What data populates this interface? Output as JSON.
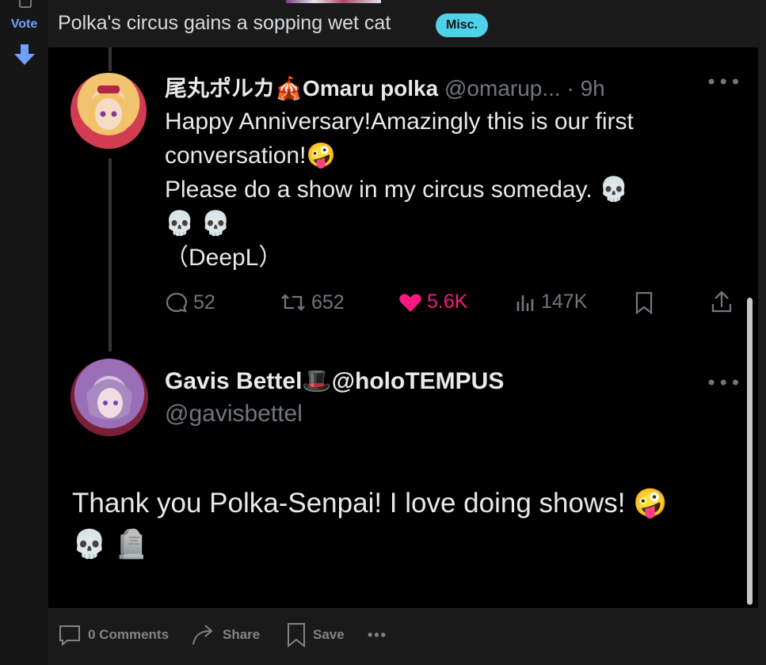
{
  "vote": {
    "label": "Vote"
  },
  "post": {
    "title": "Polka's circus gains a sopping wet cat",
    "flair": "Misc."
  },
  "tweet1": {
    "display_name": "尾丸ポルカ",
    "name_suffix": "Omaru polka",
    "handle": "@omarup...",
    "time": "· 9h",
    "line1": "Happy Anniversary!Amazingly this is our first",
    "line2": "conversation!",
    "line3": "Please do a show in my circus someday.",
    "line5": "（DeepL）",
    "replies": "52",
    "retweets": "652",
    "likes": "5.6K",
    "views": "147K"
  },
  "tweet2": {
    "display_name": "Gavis Bettel",
    "name_suffix": "@holoTEMPUS",
    "handle": "@gavisbettel",
    "line1": "Thank you Polka-Senpai! I love doing shows!"
  },
  "actions": {
    "comments": "0 Comments",
    "share": "Share",
    "save": "Save"
  },
  "colors": {
    "accent": "#4fd1e8",
    "like": "#f91880",
    "vote": "#6ea1ff"
  }
}
